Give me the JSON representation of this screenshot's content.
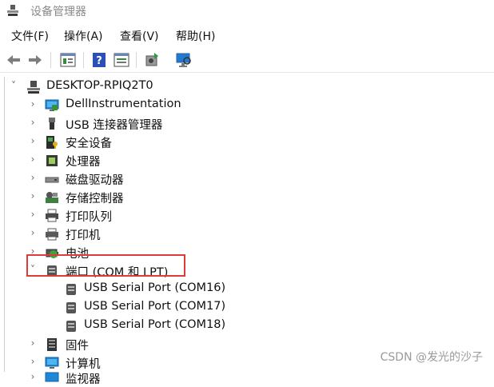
{
  "window": {
    "title": "设备管理器"
  },
  "menu": [
    "文件(F)",
    "操作(A)",
    "查看(V)",
    "帮助(H)"
  ],
  "toolbar": [
    "back-icon",
    "forward-icon",
    "properties-icon",
    "help-icon",
    "console-tree-icon",
    "update-driver-icon",
    "scan-hardware-icon"
  ],
  "tree": {
    "root": "DESKTOP-RPIQ2T0",
    "categories": [
      {
        "label": "DellInstrumentation",
        "icon": "dell-instrumentation-icon",
        "expanded": false
      },
      {
        "label": "USB 连接器管理器",
        "icon": "usb-connector-icon",
        "expanded": false
      },
      {
        "label": "安全设备",
        "icon": "security-device-icon",
        "expanded": false
      },
      {
        "label": "处理器",
        "icon": "processor-icon",
        "expanded": false
      },
      {
        "label": "磁盘驱动器",
        "icon": "disk-drive-icon",
        "expanded": false
      },
      {
        "label": "存储控制器",
        "icon": "storage-controller-icon",
        "expanded": false
      },
      {
        "label": "打印队列",
        "icon": "print-queue-icon",
        "expanded": false
      },
      {
        "label": "打印机",
        "icon": "printer-icon",
        "expanded": false
      },
      {
        "label": "电池",
        "icon": "battery-icon",
        "expanded": false
      },
      {
        "label": "端口 (COM 和 LPT)",
        "icon": "port-icon",
        "expanded": true,
        "children": [
          "USB Serial Port (COM16)",
          "USB Serial Port (COM17)",
          "USB Serial Port (COM18)"
        ]
      },
      {
        "label": "固件",
        "icon": "firmware-icon",
        "expanded": false
      },
      {
        "label": "计算机",
        "icon": "computer-icon",
        "expanded": false
      },
      {
        "label": "监视器",
        "icon": "monitor-icon",
        "expanded": false
      }
    ]
  },
  "watermark": "CSDN @发光的沙子",
  "colors": {
    "highlight": "#e03a3a",
    "accent": "#1f6fd1"
  }
}
